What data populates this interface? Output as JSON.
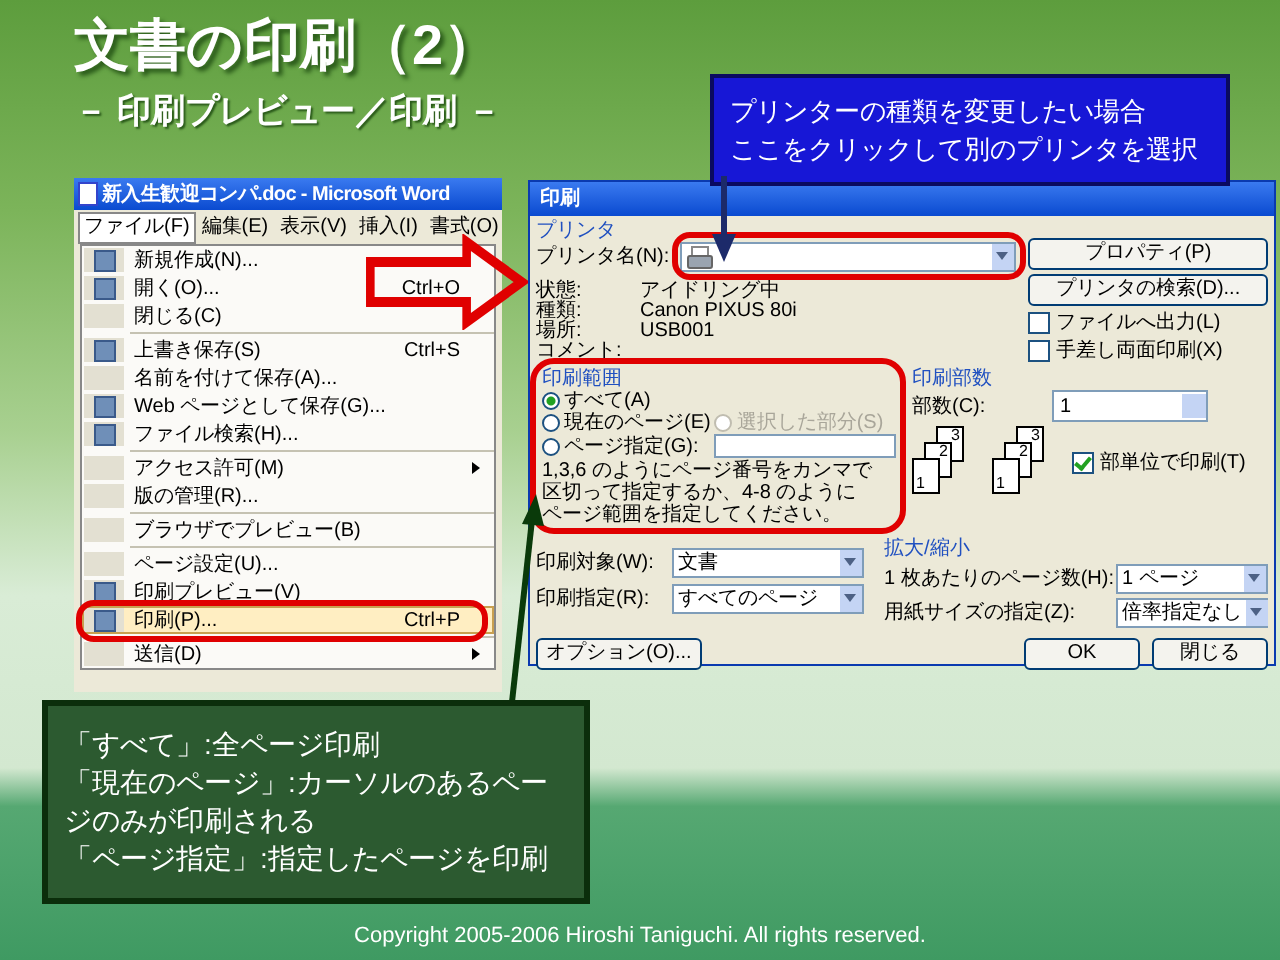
{
  "title": "文書の印刷（2）",
  "subtitle": "－ 印刷プレビュー／印刷 －",
  "printer_callout": [
    "プリンターの種類を変更したい場合",
    "ここをクリックして別のプリンタを選択"
  ],
  "word_window": {
    "title": "新入生歓迎コンパ.doc - Microsoft Word",
    "menus": [
      {
        "label": "ファイル(F)",
        "selected": true
      },
      {
        "label": "編集(E)",
        "selected": false
      },
      {
        "label": "表示(V)",
        "selected": false
      },
      {
        "label": "挿入(I)",
        "selected": false
      },
      {
        "label": "書式(O)",
        "selected": false
      }
    ],
    "menu_groups": [
      [
        {
          "label": "新規作成(N)...",
          "kind": "item",
          "has_icon": true,
          "selected": false
        },
        {
          "label": "開く(O)...",
          "shortcut": "Ctrl+O",
          "kind": "item",
          "has_icon": true,
          "selected": false
        },
        {
          "label": "閉じる(C)",
          "kind": "item",
          "has_icon": false,
          "selected": false
        }
      ],
      [
        {
          "label": "上書き保存(S)",
          "shortcut": "Ctrl+S",
          "kind": "item",
          "has_icon": true,
          "selected": false
        },
        {
          "label": "名前を付けて保存(A)...",
          "kind": "item",
          "has_icon": false,
          "selected": false
        },
        {
          "label": "Web ページとして保存(G)...",
          "kind": "item",
          "has_icon": true,
          "selected": false
        },
        {
          "label": "ファイル検索(H)...",
          "kind": "item",
          "has_icon": true,
          "selected": false
        }
      ],
      [
        {
          "label": "アクセス許可(M)",
          "kind": "submenu",
          "has_icon": false,
          "selected": false
        },
        {
          "label": "版の管理(R)...",
          "kind": "item",
          "has_icon": false,
          "selected": false
        }
      ],
      [
        {
          "label": "ブラウザでプレビュー(B)",
          "kind": "item",
          "has_icon": false,
          "selected": false
        }
      ],
      [
        {
          "label": "ページ設定(U)...",
          "kind": "item",
          "has_icon": false,
          "selected": false
        },
        {
          "label": "印刷プレビュー(V)",
          "kind": "item",
          "has_icon": true,
          "selected": false
        },
        {
          "label": "印刷(P)...",
          "shortcut": "Ctrl+P",
          "kind": "item",
          "has_icon": true,
          "selected": true
        }
      ],
      [
        {
          "label": "送信(D)",
          "kind": "submenu",
          "has_icon": false,
          "selected": false
        }
      ]
    ]
  },
  "print_dialog": {
    "title": "印刷",
    "printer": {
      "group_label": "プリンタ",
      "name_label": "プリンタ名(N):",
      "info": [
        {
          "label": "状態:",
          "value": "アイドリング中"
        },
        {
          "label": "種類:",
          "value": "Canon PIXUS 80i"
        },
        {
          "label": "場所:",
          "value": "USB001"
        },
        {
          "label": "コメント:"
        }
      ],
      "buttons": [
        "プロパティ(P)",
        "プリンタの検索(D)..."
      ],
      "options": [
        {
          "label": "ファイルへ出力(L)",
          "checked": false
        },
        {
          "label": "手差し両面印刷(X)",
          "checked": false
        }
      ]
    },
    "range": {
      "group_label": "印刷範囲",
      "options": [
        {
          "label": "すべて(A)",
          "selected": true,
          "disabled": false
        },
        {
          "label": "現在のページ(E)",
          "selected": false,
          "disabled": false
        },
        {
          "label": "選択した部分(S)",
          "selected": false,
          "disabled": true
        },
        {
          "label": "ページ指定(G):",
          "selected": false,
          "disabled": false
        }
      ],
      "hint": "1,3,6 のようにページ番号をカンマで区切って指定するか、4-8 のようにページ範囲を指定してください。"
    },
    "copies": {
      "group_label": "印刷部数",
      "count_label": "部数(C):",
      "count_value": "1",
      "page_stacks": [
        [
          "3",
          "2",
          "1"
        ],
        [
          "3",
          "2",
          "1"
        ]
      ],
      "collate": {
        "label": "部単位で印刷(T)",
        "checked": true
      }
    },
    "print_what": [
      {
        "label": "印刷対象(W):",
        "value": "文書"
      },
      {
        "label": "印刷指定(R):",
        "value": "すべてのページ"
      }
    ],
    "zoom": {
      "group_label": "拡大/縮小",
      "rows": [
        {
          "label": "1 枚あたりのページ数(H):",
          "value": "1 ページ"
        },
        {
          "label": "用紙サイズの指定(Z):",
          "value": "倍率指定なし"
        }
      ]
    },
    "options_button": "オプション(O)...",
    "buttons": [
      "OK",
      "閉じる"
    ]
  },
  "range_callout": [
    "「すべて」:全ページ印刷",
    "「現在のページ」:カーソルのあるページのみが印刷される",
    "「ページ指定」:指定したページを印刷"
  ],
  "copyright": "Copyright 2005-2006 Hiroshi Taniguchi. All rights reserved."
}
